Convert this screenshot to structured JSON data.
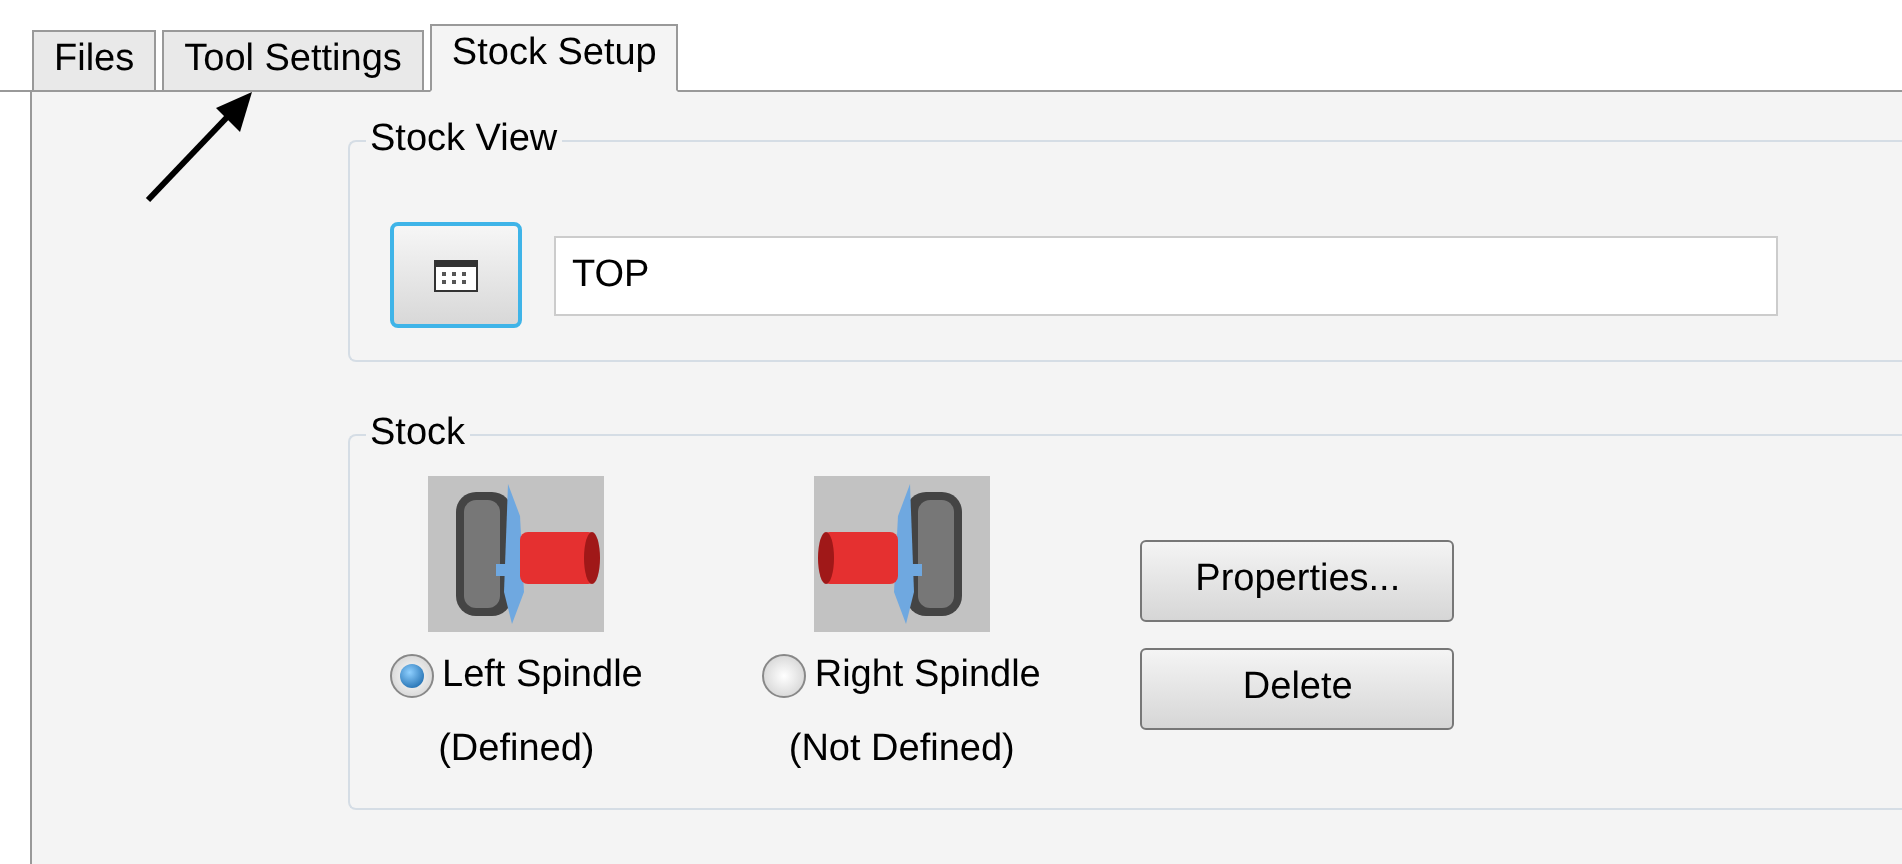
{
  "tabs": [
    {
      "label": "Files",
      "selected": false
    },
    {
      "label": "Tool Settings",
      "selected": false
    },
    {
      "label": "Stock Setup",
      "selected": true
    }
  ],
  "stock_view": {
    "title": "Stock View",
    "value": "TOP"
  },
  "stock": {
    "title": "Stock",
    "spindles": [
      {
        "kind": "left",
        "label": "Left Spindle",
        "status": "(Defined)",
        "selected": true
      },
      {
        "kind": "right",
        "label": "Right Spindle",
        "status": "(Not Defined)",
        "selected": false
      }
    ],
    "buttons": [
      "Properties...",
      "Delete"
    ]
  }
}
